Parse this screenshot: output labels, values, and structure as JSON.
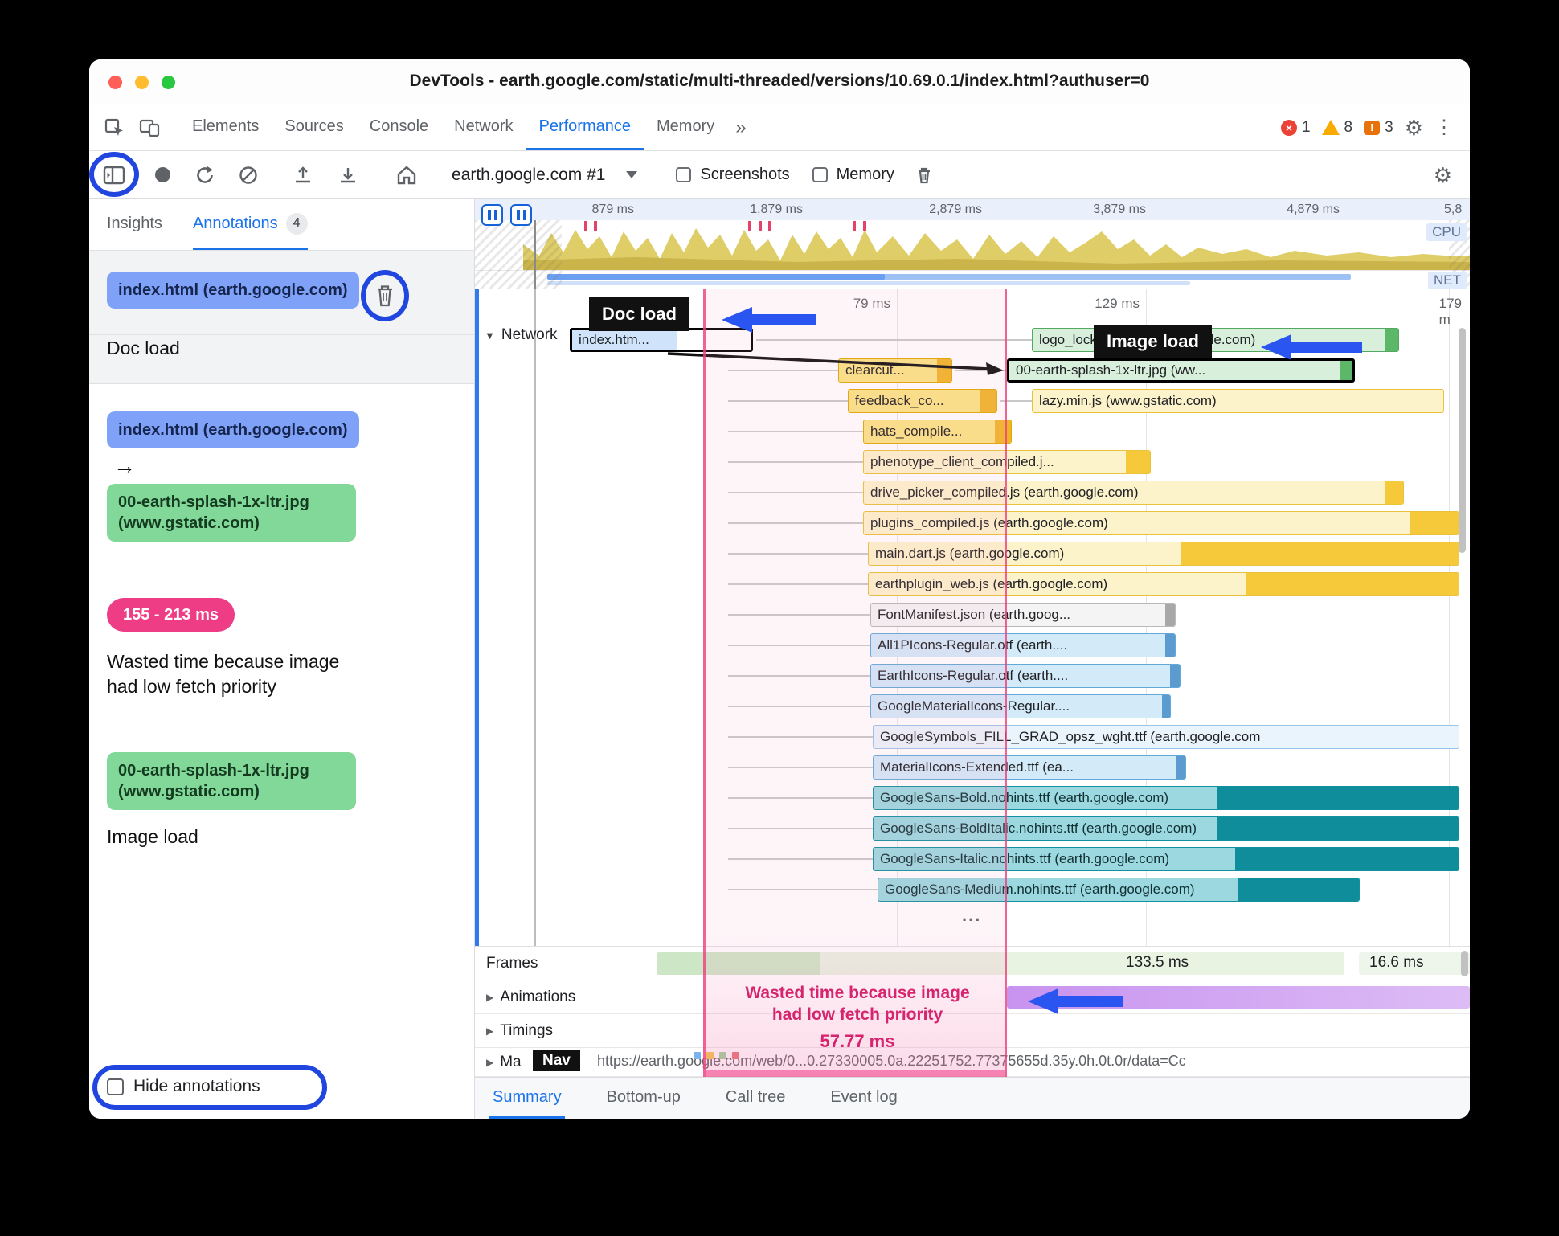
{
  "window": {
    "title": "DevTools - earth.google.com/static/multi-threaded/versions/10.69.0.1/index.html?authuser=0"
  },
  "main_tabs": {
    "items": [
      "Elements",
      "Sources",
      "Console",
      "Network",
      "Performance",
      "Memory"
    ],
    "active": "Performance",
    "overflow": "»",
    "errors": "1",
    "warnings": "8",
    "issues": "3"
  },
  "controls": {
    "target_selector": "earth.google.com #1",
    "screenshots": "Screenshots",
    "memory": "Memory"
  },
  "sidebar": {
    "tab_insights": "Insights",
    "tab_annotations": "Annotations",
    "annotations_count": "4",
    "card1": {
      "pill": "index.html (earth.google.com)",
      "label": "Doc load"
    },
    "card2": {
      "pill_from": "index.html (earth.google.com)",
      "arrow": "→",
      "pill_to": "00-earth-splash-1x-ltr.jpg (www.gstatic.com)"
    },
    "card3": {
      "pill": "155 - 213 ms",
      "label": "Wasted time because image had low fetch priority"
    },
    "card4": {
      "pill": "00-earth-splash-1x-ltr.jpg (www.gstatic.com)",
      "label": "Image load"
    },
    "hide_annotations": "Hide annotations"
  },
  "minimap": {
    "ticks": [
      "879 ms",
      "1,879 ms",
      "2,879 ms",
      "3,879 ms",
      "4,879 ms",
      "5,8"
    ],
    "cpu": "CPU",
    "net": "NET"
  },
  "waterfall": {
    "ticks": [
      "79 ms",
      "129 ms",
      "179 m"
    ],
    "track": "Network",
    "doc_load": "Doc load",
    "image_load": "Image load",
    "ellipsis": "...",
    "requests": [
      "index.htm...",
      "logo_lockup.svg (earth.google.com)",
      "clearcut...",
      "00-earth-splash-1x-ltr.jpg (ww...",
      "feedback_co...",
      "lazy.min.js (www.gstatic.com)",
      "hats_compile...",
      "phenotype_client_compiled.j...",
      "drive_picker_compiled.js (earth.google.com)",
      "plugins_compiled.js (earth.google.com)",
      "main.dart.js (earth.google.com)",
      "earthplugin_web.js (earth.google.com)",
      "FontManifest.json (earth.goog...",
      "All1PIcons-Regular.otf (earth....",
      "EarthIcons-Regular.otf (earth....",
      "GoogleMaterialIcons-Regular....",
      "GoogleSymbols_FILL_GRAD_opsz_wght.ttf (earth.google.com",
      "MaterialIcons-Extended.ttf (ea...",
      "GoogleSans-Bold.nohints.ttf (earth.google.com)",
      "GoogleSans-BoldItalic.nohints.ttf (earth.google.com)",
      "GoogleSans-Italic.nohints.ttf (earth.google.com)",
      "GoogleSans-Medium.nohints.ttf (earth.google.com)"
    ]
  },
  "overlay": {
    "line1": "Wasted time because image",
    "line2": "had low fetch priority",
    "duration": "57.77 ms"
  },
  "tracks": {
    "frames": "Frames",
    "frames_time1": "133.5 ms",
    "frames_time2": "16.6 ms",
    "animations": "Animations",
    "timings": "Timings",
    "main_track": "Ma",
    "nav_badge": "Nav",
    "nav_url": "https://earth.google.com/web/0...0.27330005.0a.22251752.77375655d.35y.0h.0t.0r/data=Cc"
  },
  "drawer_tabs": {
    "items": [
      "Summary",
      "Bottom-up",
      "Call tree",
      "Event log"
    ],
    "active": "Summary"
  }
}
